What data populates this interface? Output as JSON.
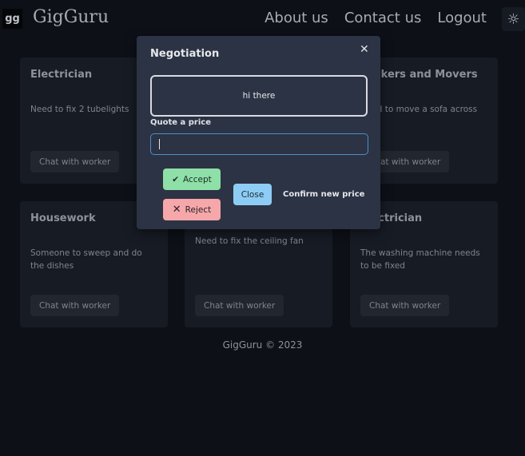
{
  "nav": {
    "logo": "gg",
    "brand": "GigGuru",
    "links": [
      "About us",
      "Contact us",
      "Logout"
    ],
    "theme_icon": "sun-icon"
  },
  "cards": [
    {
      "title": "Electrician",
      "description": "Need to fix 2 tubelights",
      "button": "Chat with worker"
    },
    {
      "title": "",
      "description": "",
      "button": ""
    },
    {
      "title": "Packers and Movers",
      "description": "Need to move a sofa across",
      "button": "Chat with worker"
    },
    {
      "title": "Housework",
      "description": "Someone to sweep and do the dishes",
      "button": "Chat with worker"
    },
    {
      "title": "",
      "description": "Need to fix the ceiling fan",
      "button": "Chat with worker"
    },
    {
      "title": "Electrician",
      "description": "The washing machine needs to be fixed",
      "button": "Chat with worker"
    }
  ],
  "footer": "GigGuru © 2023",
  "modal": {
    "title": "Negotiation",
    "message": "hi there",
    "quote_label": "Quote a price",
    "quote_value": "",
    "accept": "Accept",
    "reject": "Reject",
    "close": "Close",
    "confirm": "Confirm new price"
  }
}
